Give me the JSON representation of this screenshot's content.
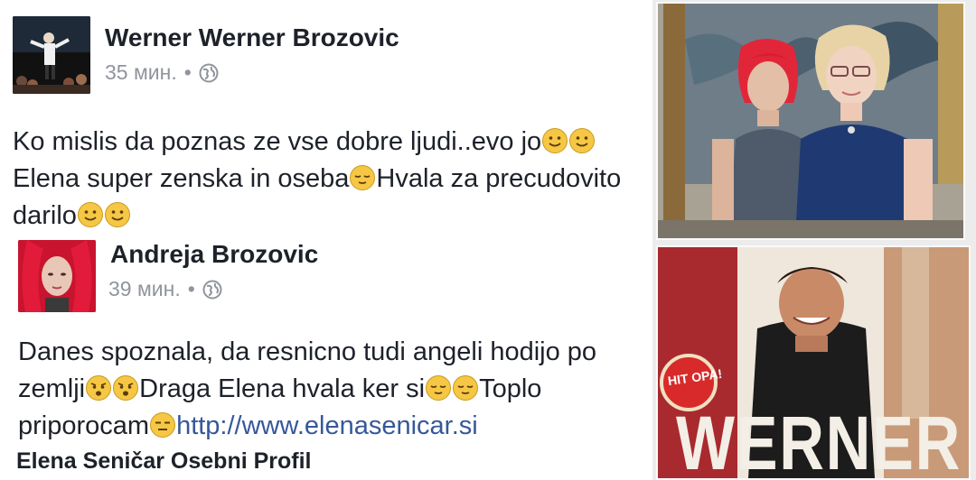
{
  "post": {
    "author": "Werner Werner Brozovic",
    "time": "35 мин.",
    "dot": "•",
    "text_lines": [
      "Ko mislis da poznas ze vse dobre ljudi..evo jo",
      "Elena super zenska in oseba",
      "Hvala za precudovito",
      "darilo"
    ]
  },
  "shared": {
    "author": "Andreja Brozovic",
    "time": "39 мин.",
    "dot": "•",
    "text_lines": [
      "Danes spoznala, da resnicno tudi angeli hodijo po",
      "zemlji",
      "Draga Elena hvala ker si",
      "Toplo",
      "priporocam",
      "http://www.elenasenicar.si"
    ]
  },
  "profile_name": "Elena Seničar Osebni Profil",
  "photo_2": {
    "sticker": "HIT OPA!",
    "title": "WERNER"
  },
  "icons": {
    "globe": "globe-icon",
    "smile": "slightly-smiling-face-icon",
    "relieved": "relieved-face-icon",
    "astonished": "astonished-face-icon",
    "expressionless": "expressionless-face-icon"
  },
  "colors": {
    "text": "#1d2129",
    "meta": "#90949c",
    "link": "#365899",
    "emoji": "#f6c744"
  }
}
